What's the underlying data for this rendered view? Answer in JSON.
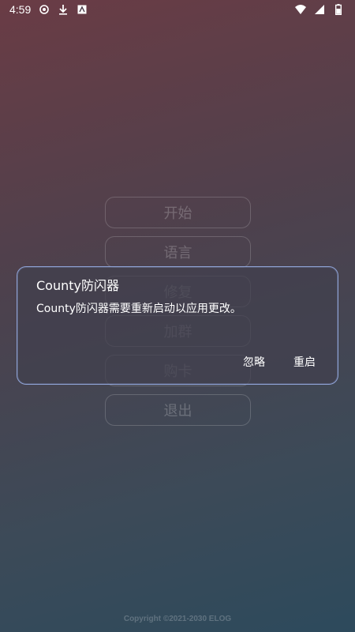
{
  "status_bar": {
    "time": "4:59",
    "left_icons": [
      "vpn-key-icon",
      "download-icon",
      "text-icon"
    ],
    "right_icons": [
      "wifi-icon",
      "signal-icon",
      "battery-icon"
    ]
  },
  "menu": {
    "items": [
      {
        "label": "开始"
      },
      {
        "label": "语言"
      },
      {
        "label": "修复"
      },
      {
        "label": "加群"
      },
      {
        "label": "购卡"
      },
      {
        "label": "退出"
      }
    ]
  },
  "dialog": {
    "title": "County防闪器",
    "message": "County防闪器需要重新启动以应用更改。",
    "ignore_label": "忽略",
    "restart_label": "重启"
  },
  "footer": {
    "copyright": "Copyright ©2021-2030 ELOG"
  },
  "colors": {
    "dialog_border": "#8fa3d6",
    "bg_top": "#6a3c45",
    "bg_bottom": "#2d4a5c"
  }
}
